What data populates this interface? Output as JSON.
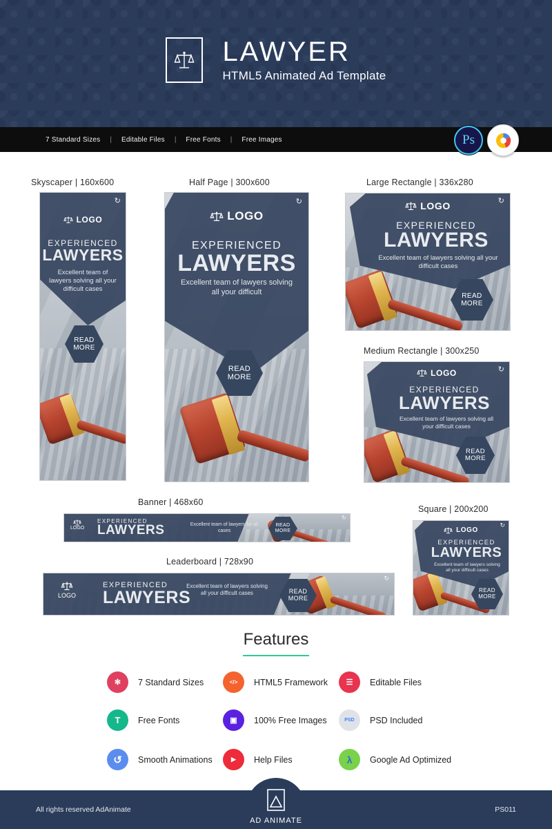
{
  "hero": {
    "title": "LAWYER",
    "subtitle": "HTML5 Animated Ad Template",
    "mark_icon": "scales-of-justice-icon"
  },
  "ribbon": {
    "items": [
      "7 Standard Sizes",
      "Editable Files",
      "Free Fonts",
      "Free Images"
    ],
    "separator": "|",
    "badges": [
      {
        "name": "photoshop-badge",
        "label": "Ps"
      },
      {
        "name": "google-ads-badge",
        "label": ""
      }
    ]
  },
  "ad_copy": {
    "logo": "LOGO",
    "eyebrow": "EXPERIENCED",
    "headline": "LAWYERS",
    "desc_full": "Excellent team of lawyers solving all your difficult cases",
    "desc_truncated": "Excellent team of lawyers solving all your difficult",
    "desc_short": "Excellent team of lawyers for all cases",
    "cta_line1": "READ",
    "cta_line2": "MORE",
    "replay_icon": "replay-arrow-icon"
  },
  "ads": [
    {
      "name": "skyscraper",
      "label": "Skyscaper | 160x600",
      "size": "160x600"
    },
    {
      "name": "half-page",
      "label": "Half Page | 300x600",
      "size": "300x600"
    },
    {
      "name": "large-rectangle",
      "label": "Large Rectangle | 336x280",
      "size": "336x280"
    },
    {
      "name": "medium-rectangle",
      "label": "Medium Rectangle | 300x250",
      "size": "300x250"
    },
    {
      "name": "banner",
      "label": "Banner | 468x60",
      "size": "468x60"
    },
    {
      "name": "leaderboard",
      "label": "Leaderboard | 728x90",
      "size": "728x90"
    },
    {
      "name": "square",
      "label": "Square | 200x200",
      "size": "200x200"
    }
  ],
  "features": {
    "title": "Features",
    "accent_color": "#2ecc8f",
    "items": [
      {
        "label": "7 Standard Sizes",
        "icon": "sizes-icon",
        "color": "#e0405f",
        "glyph": "✣"
      },
      {
        "label": "HTML5 Framework",
        "icon": "html5-icon",
        "color": "#f4632e",
        "glyph": "‹›"
      },
      {
        "label": "Editable Files",
        "icon": "edit-files-icon",
        "color": "#e8344e",
        "glyph": "☰"
      },
      {
        "label": "Free Fonts",
        "icon": "font-icon",
        "color": "#14b88a",
        "glyph": "T"
      },
      {
        "label": "100% Free Images",
        "icon": "images-icon",
        "color": "#5b21e0",
        "glyph": "▣"
      },
      {
        "label": "PSD Included",
        "icon": "psd-icon",
        "color": "#dfe3e8",
        "glyph": "PSD"
      },
      {
        "label": "Smooth Animations",
        "icon": "animation-icon",
        "color": "#5b8def",
        "glyph": "↺"
      },
      {
        "label": "Help Files",
        "icon": "help-files-icon",
        "color": "#ee2b3b",
        "glyph": "▶"
      },
      {
        "label": "Google Ad Optimized",
        "icon": "google-ads-icon",
        "color": "#7ad14a",
        "glyph": "λ"
      }
    ]
  },
  "footer": {
    "copyright": "All rights reserved AdAnimate",
    "code": "PS011",
    "brand": "AD ANIMATE",
    "brand_icon": "ad-animate-logo-icon"
  }
}
